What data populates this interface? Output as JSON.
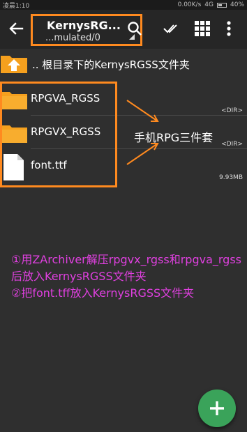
{
  "status_bar": {
    "time": "凌晨1:10",
    "network_speed": "0.00K/s",
    "network_type": "4G",
    "battery": "40%"
  },
  "toolbar": {
    "title": "KernysRG...",
    "path": "...mulated/0",
    "icons": [
      "back-arrow-icon",
      "search-icon",
      "select-check-icon",
      "grid-view-icon",
      "more-vert-icon"
    ]
  },
  "parent_dir": {
    "label": ".. 根目录下的KernysRGSS文件夹",
    "icon": "folder-up-icon"
  },
  "files": [
    {
      "name": "RPGVA_RGSS",
      "meta": "<DIR>",
      "icon": "folder-icon"
    },
    {
      "name": "RPGVX_RGSS",
      "meta": "<DIR>",
      "icon": "folder-icon"
    },
    {
      "name": "font.ttf",
      "meta": "9.93MB",
      "icon": "file-icon"
    }
  ],
  "annotation": "手机RPG三件套",
  "instructions": [
    "①用ZArchiver解压rpgvx_rgss和rpgva_rgss后放入KernysRGSS文件夹",
    "②把font.tff放入KernysRGSS文件夹"
  ],
  "fab": {
    "icon": "plus-icon"
  },
  "colors": {
    "background": "#2f2f2f",
    "toolbar": "#262626",
    "folder": "#f5a01e",
    "highlight_box": "#ff8a1f",
    "instruction_text": "#e040e0",
    "fab": "#3aa35a"
  }
}
